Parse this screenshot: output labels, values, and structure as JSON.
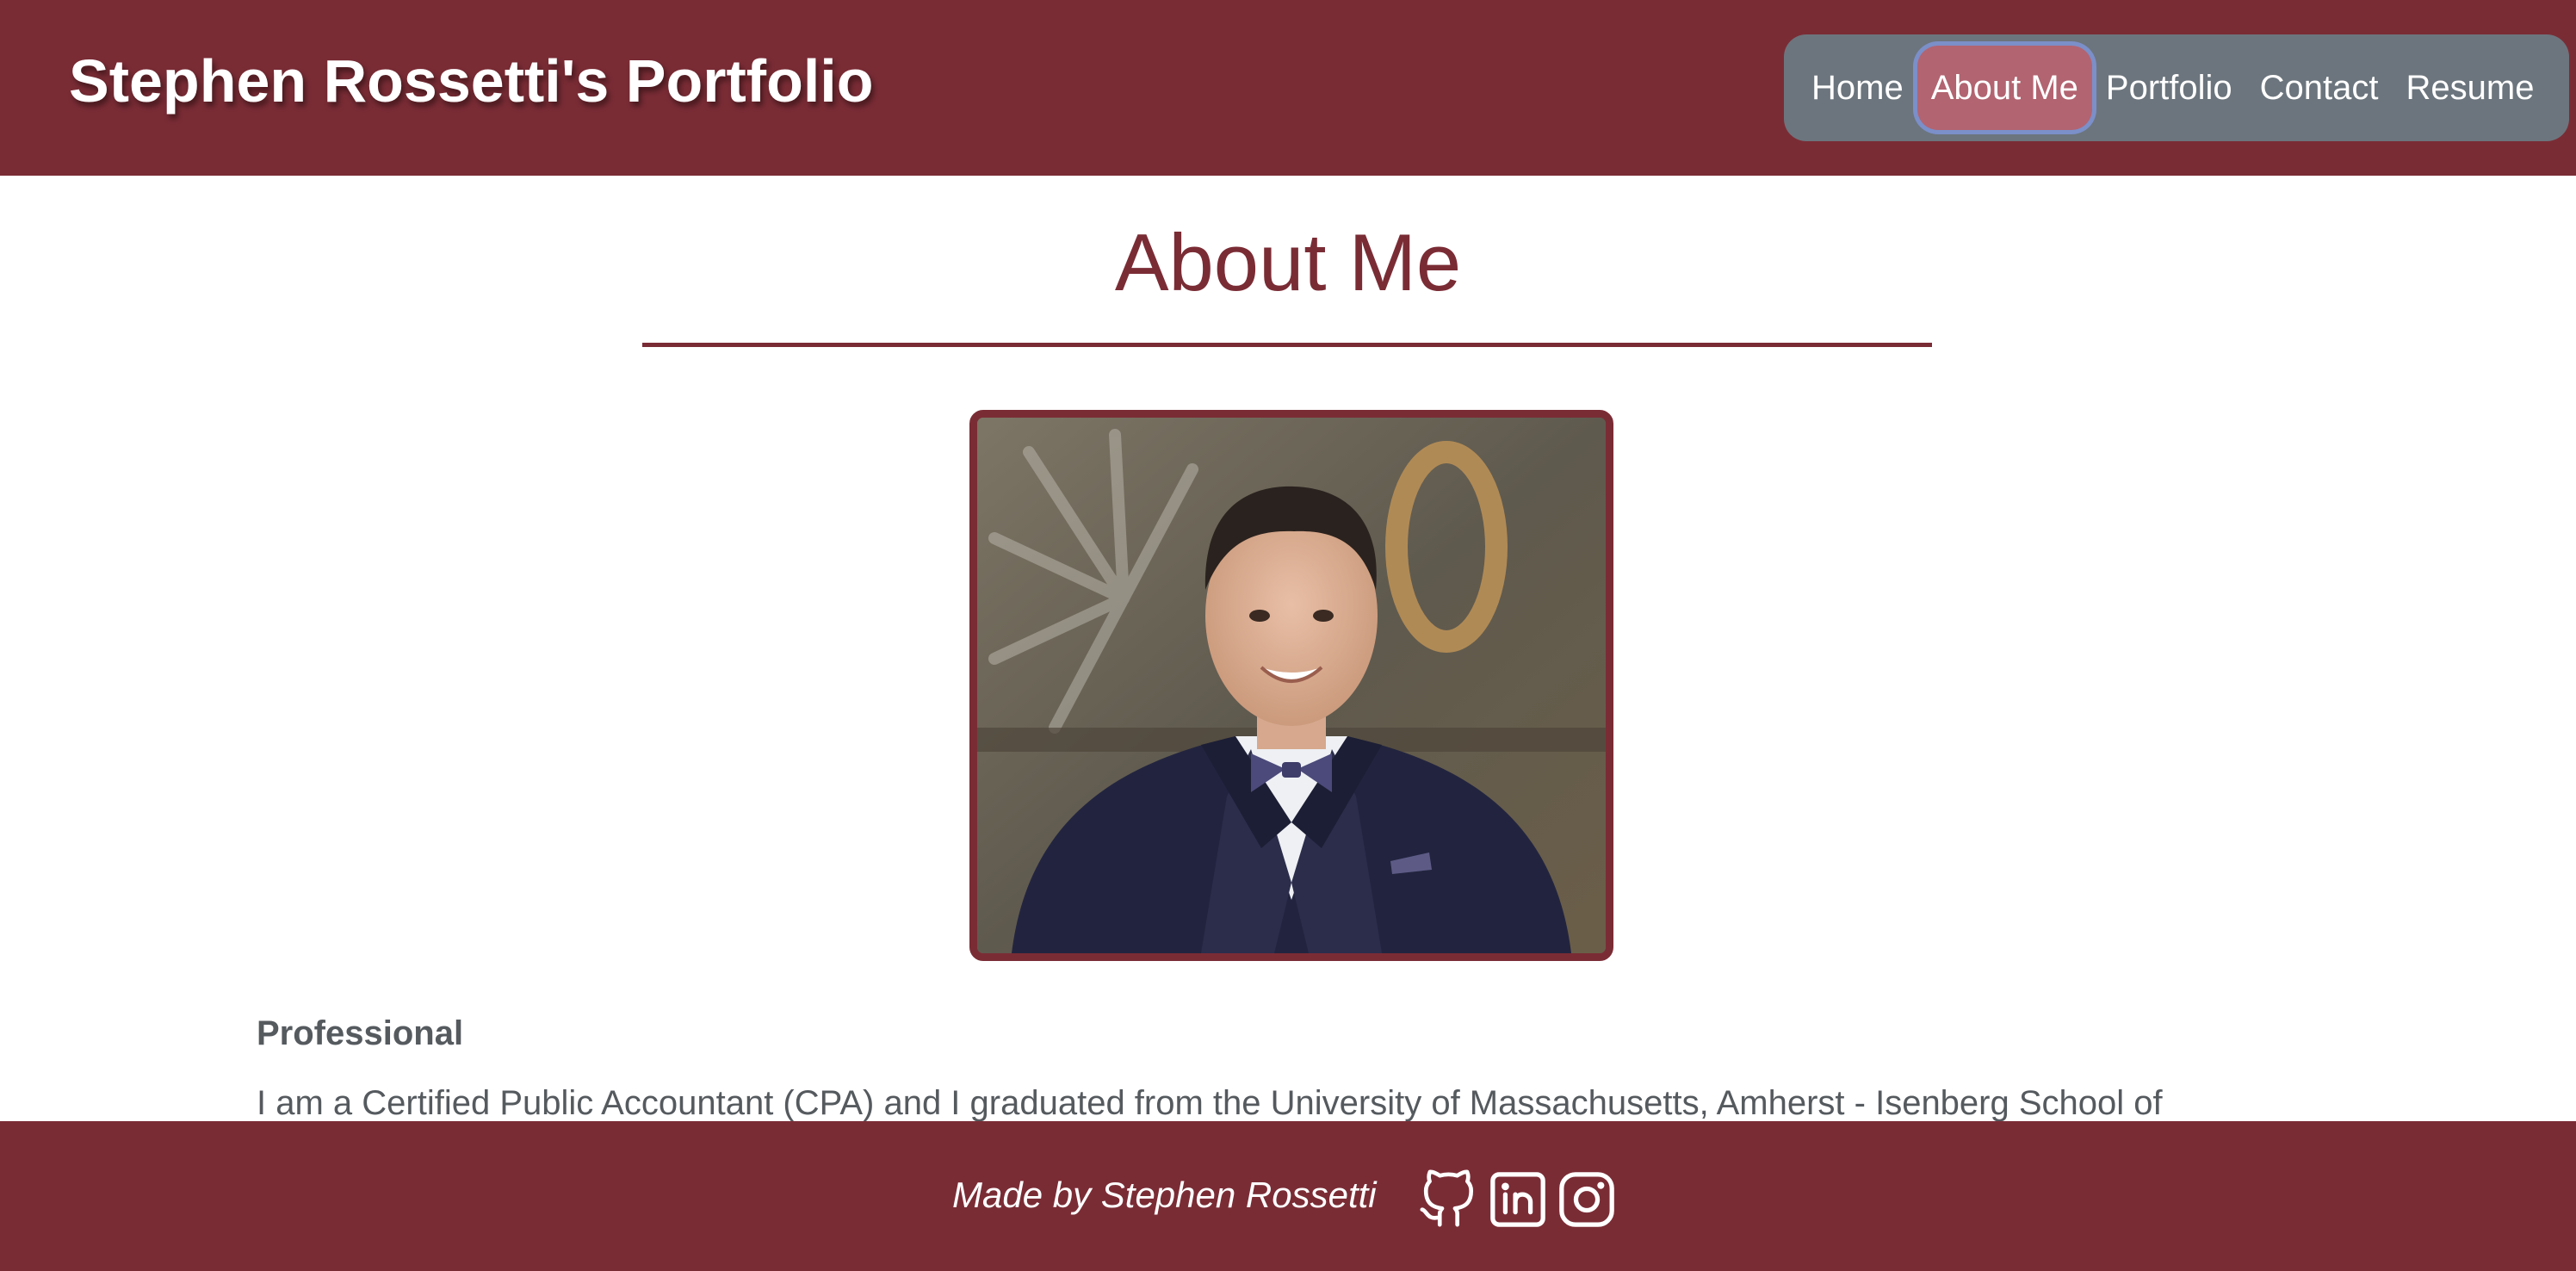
{
  "header": {
    "site_title": "Stephen Rossetti's Portfolio",
    "nav": [
      "Home",
      "About Me",
      "Portfolio",
      "Contact",
      "Resume"
    ],
    "active_nav": "About Me"
  },
  "main": {
    "heading": "About Me",
    "photo_icon": "profile-photo",
    "section_title": "Professional",
    "paragraph": "I am a Certified Public Accountant (CPA) and I graduated from the University of Massachusetts, Amherst - Isenberg School of"
  },
  "footer": {
    "credit": "Made by Stephen Rossetti",
    "social_icons": [
      "github-icon",
      "linkedin-icon",
      "instagram-icon"
    ]
  },
  "colors": {
    "brand": "#7a2c35",
    "nav_bg": "#6c757d",
    "nav_active": "#b26471",
    "body_text": "#555a5f"
  }
}
